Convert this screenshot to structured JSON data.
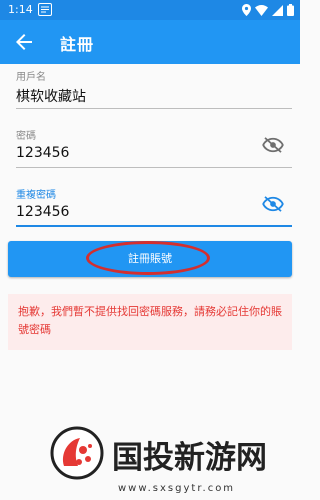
{
  "status_bar": {
    "time": "1:14"
  },
  "app_bar": {
    "title": "註冊"
  },
  "form": {
    "username": {
      "label": "用戶名",
      "value": "棋软收藏站"
    },
    "password": {
      "label": "密碼",
      "value": "123456"
    },
    "confirm_password": {
      "label": "重複密碼",
      "value": "123456"
    }
  },
  "register_button": {
    "label": "註冊賬號"
  },
  "warning": {
    "text": "抱歉，我們暫不提供找回密碼服務，請務必記住你的賬號密碼"
  },
  "watermark": {
    "brand_text": "国投新游网",
    "url": "www.sxsgytr.com"
  },
  "colors": {
    "primary": "#2196f3",
    "status_bar": "#1e88e5",
    "warning_text": "#e53935",
    "warning_bg": "#fdecec",
    "highlight_ellipse": "#d32f2f"
  },
  "icons": {
    "back": "arrow-left-icon",
    "visibility": "eye-off-icon",
    "visibility_active": "eye-off-icon-active"
  }
}
